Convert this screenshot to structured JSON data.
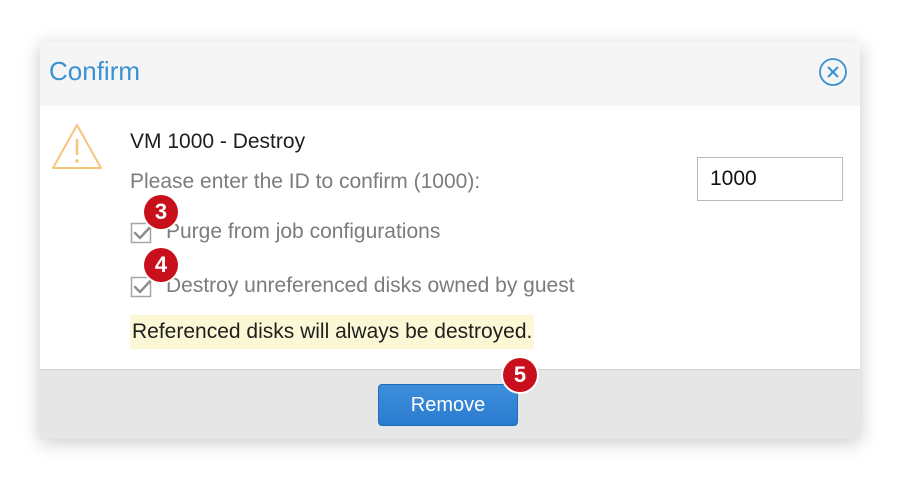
{
  "dialog": {
    "title": "Confirm",
    "heading": "VM 1000 - Destroy",
    "prompt": "Please enter the ID to confirm (1000):",
    "id_input_value": "1000",
    "options": [
      {
        "label": "Purge from job configurations",
        "checked": true
      },
      {
        "label": "Destroy unreferenced disks owned by guest",
        "checked": true
      }
    ],
    "notice": "Referenced disks will always be destroyed.",
    "remove_label": "Remove"
  },
  "badges": [
    "3",
    "4",
    "5"
  ],
  "colors": {
    "title": "#3892d4",
    "button": "#2f82d4",
    "notice_bg": "#fcf8d6",
    "badge": "#c8101c",
    "warning": "#f5c57a"
  },
  "icons": {
    "close": "close-circle-icon",
    "warning": "warning-triangle-icon",
    "checkbox": "checkbox-checked-icon"
  }
}
